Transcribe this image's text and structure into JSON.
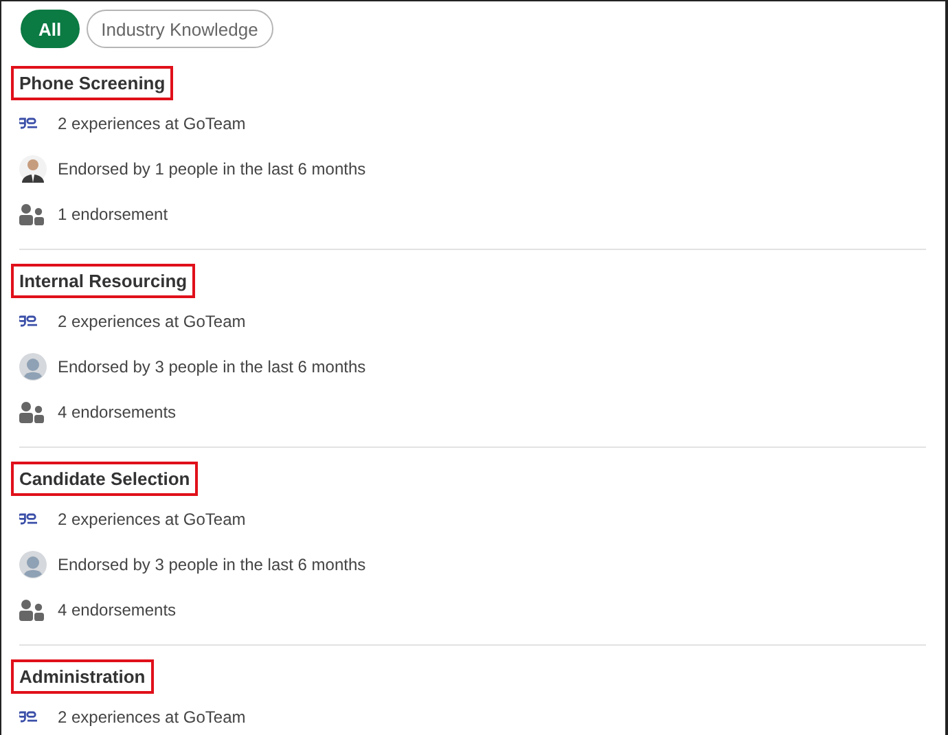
{
  "filters": [
    {
      "label": "All",
      "selected": true
    },
    {
      "label": "Industry Knowledge",
      "selected": false
    }
  ],
  "skills": [
    {
      "name": "Phone Screening",
      "highlighted": true,
      "rows": [
        {
          "kind": "experience",
          "text": "2 experiences at GoTeam"
        },
        {
          "kind": "photo",
          "text": "Endorsed by 1 people in the last 6 months"
        },
        {
          "kind": "count",
          "text": "1 endorsement"
        }
      ]
    },
    {
      "name": "Internal Resourcing",
      "highlighted": true,
      "rows": [
        {
          "kind": "experience",
          "text": "2 experiences at GoTeam"
        },
        {
          "kind": "avatar",
          "text": "Endorsed by 3 people in the last 6 months"
        },
        {
          "kind": "count",
          "text": "4 endorsements"
        }
      ]
    },
    {
      "name": "Candidate Selection",
      "highlighted": true,
      "rows": [
        {
          "kind": "experience",
          "text": "2 experiences at GoTeam"
        },
        {
          "kind": "avatar",
          "text": "Endorsed by 3 people in the last 6 months"
        },
        {
          "kind": "count",
          "text": "4 endorsements"
        }
      ]
    },
    {
      "name": "Administration",
      "highlighted": true,
      "rows": [
        {
          "kind": "experience",
          "text": "2 experiences at GoTeam"
        }
      ]
    }
  ]
}
